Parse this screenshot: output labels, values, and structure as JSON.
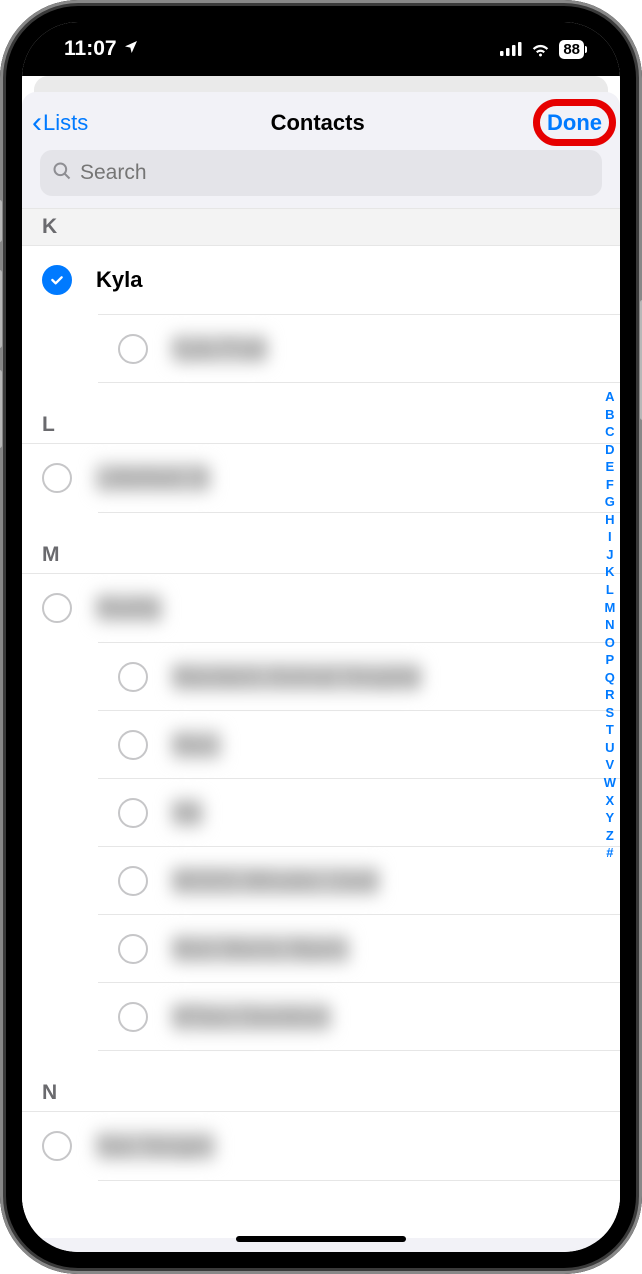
{
  "status": {
    "time": "11:07",
    "battery": "88"
  },
  "nav": {
    "back_label": "Lists",
    "title": "Contacts",
    "done_label": "Done"
  },
  "search": {
    "placeholder": "Search"
  },
  "sections": [
    {
      "letter": "K",
      "style": "grey",
      "rows": [
        {
          "name": "Kyla",
          "checked": true,
          "blurred": false,
          "bold": true
        },
        {
          "name": "Kyla Pratt",
          "checked": false,
          "blurred": true,
          "bold": false
        }
      ]
    },
    {
      "letter": "L",
      "style": "plain",
      "rows": [
        {
          "name": "Littlefield St",
          "checked": false,
          "blurred": true,
          "bold": false
        }
      ]
    },
    {
      "letter": "M",
      "style": "plain",
      "rows": [
        {
          "name": "Maddy",
          "checked": false,
          "blurred": true,
          "bold": false
        },
        {
          "name": "Mandarin Animal Hospital",
          "checked": false,
          "blurred": true,
          "bold": false
        },
        {
          "name": "Marc",
          "checked": false,
          "blurred": true,
          "bold": false
        },
        {
          "name": "Me",
          "checked": false,
          "blurred": true,
          "bold": false
        },
        {
          "name": "MODS Minutes Used",
          "checked": false,
          "blurred": true,
          "bold": false
        },
        {
          "name": "Mort Morris Myers",
          "checked": false,
          "blurred": true,
          "bold": false
        },
        {
          "name": "MTara Davidson",
          "checked": false,
          "blurred": true,
          "bold": false
        }
      ]
    },
    {
      "letter": "N",
      "style": "plain",
      "rows": [
        {
          "name": "Nan Norgen",
          "checked": false,
          "blurred": true,
          "bold": false
        }
      ]
    }
  ],
  "index_letters": [
    "A",
    "B",
    "C",
    "D",
    "E",
    "F",
    "G",
    "H",
    "I",
    "J",
    "K",
    "L",
    "M",
    "N",
    "O",
    "P",
    "Q",
    "R",
    "S",
    "T",
    "U",
    "V",
    "W",
    "X",
    "Y",
    "Z",
    "#"
  ]
}
